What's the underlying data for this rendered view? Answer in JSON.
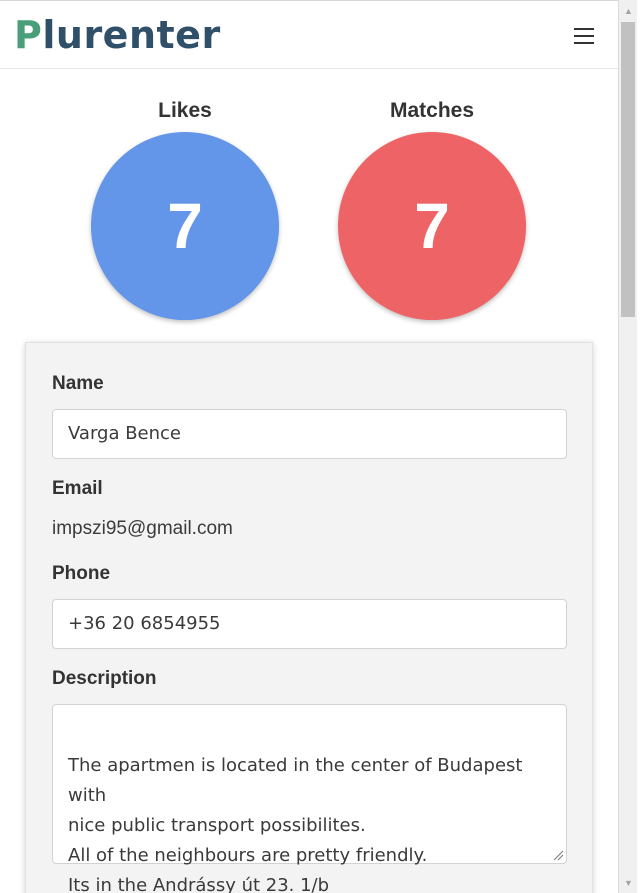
{
  "brand": {
    "initial": "P",
    "rest": "lurenter"
  },
  "stats": {
    "likes": {
      "label": "Likes",
      "value": "7",
      "color": "#6395e8"
    },
    "matches": {
      "label": "Matches",
      "value": "7",
      "color": "#ee6466"
    }
  },
  "profile": {
    "name_label": "Name",
    "name_value": "Varga Bence",
    "email_label": "Email",
    "email_value": "impszi95@gmail.com",
    "phone_label": "Phone",
    "phone_value": "+36 20 6854955",
    "description_label": "Description",
    "description_value": "The apartmen is located in the center of Budapest with\nnice public transport possibilites.\nAll of the neighbours are pretty friendly.\nIts in the Andrássy út 23. 1/b"
  },
  "icons": {
    "menu": "hamburger-menu-icon",
    "resize": "resize-grip-icon"
  },
  "colors": {
    "brand_green": "#4a9e79",
    "brand_navy": "#30506a"
  }
}
